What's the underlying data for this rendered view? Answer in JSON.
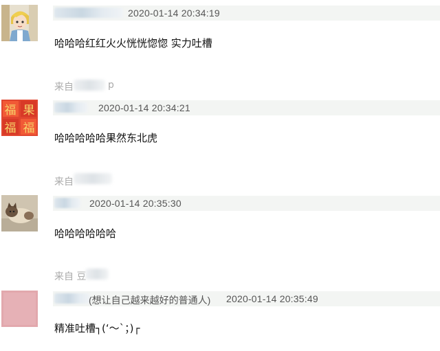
{
  "comments": [
    {
      "timestamp": "2020-01-14 20:34:19",
      "text": "哈哈哈红红火火恍恍惚惚 实力吐槽",
      "source_prefix": "来自",
      "source_suffix": "p",
      "avatar_icon": "cartoon-girl-avatar"
    },
    {
      "timestamp": "2020-01-14 20:34:21",
      "text": "哈哈哈哈哈果然东北虎",
      "source_prefix": "来自",
      "avatar_icon": "fu-character-avatar"
    },
    {
      "timestamp": "2020-01-14 20:35:30",
      "text": "哈哈哈哈哈哈",
      "source_prefix": "来自 豆",
      "avatar_icon": "cat-photo-avatar"
    },
    {
      "signature": "(想让自己越来越好的普通人)",
      "timestamp": "2020-01-14 20:35:49",
      "text": "精准吐槽┐(‘～`；)┌",
      "avatar_icon": "pink-square-avatar"
    }
  ],
  "colors": {
    "meta_bar_bg": "#f3f5f3",
    "source_text": "#aaaaaa",
    "timestamp_text": "#555555"
  }
}
